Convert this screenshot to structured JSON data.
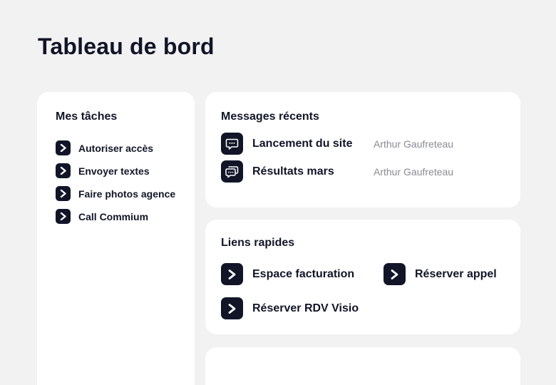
{
  "page": {
    "title": "Tableau de bord"
  },
  "tasks": {
    "title": "Mes tâches",
    "items": [
      {
        "label": "Autoriser accès",
        "icon": "chevron-right-icon"
      },
      {
        "label": "Envoyer textes",
        "icon": "chevron-right-icon"
      },
      {
        "label": "Faire photos agence",
        "icon": "chevron-right-icon"
      },
      {
        "label": "Call Commium",
        "icon": "chevron-right-icon"
      }
    ]
  },
  "messages": {
    "title": "Messages récents",
    "items": [
      {
        "subject": "Lancement du site",
        "author": "Arthur Gaufreteau",
        "icon": "chat-bubble-icon"
      },
      {
        "subject": "Résultats mars",
        "author": "Arthur Gaufreteau",
        "icon": "chat-bubbles-icon"
      }
    ]
  },
  "quick_links": {
    "title": "Liens rapides",
    "items": [
      {
        "label": "Espace facturation",
        "icon": "chevron-right-icon"
      },
      {
        "label": "Réserver appel",
        "icon": "chevron-right-icon"
      },
      {
        "label": "Réserver RDV Visio",
        "icon": "chevron-right-icon"
      }
    ]
  },
  "colors": {
    "background": "#f2f2f2",
    "card": "#ffffff",
    "primary": "#121528",
    "muted_text": "#8a8b93"
  }
}
